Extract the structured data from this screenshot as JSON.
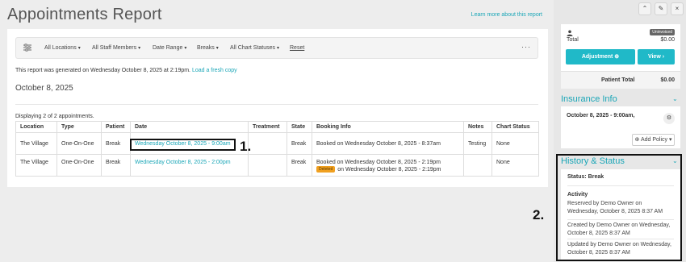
{
  "page_title": "Appointments Report",
  "learn_link": "Learn more about this report",
  "filters": {
    "locations": "All Locations",
    "staff": "All Staff Members",
    "date_range": "Date Range",
    "breaks": "Breaks",
    "chart_statuses": "All Chart Statuses",
    "reset": "Reset",
    "more": "···"
  },
  "generated": {
    "text": "This report was generated on Wednesday October 8, 2025 at 2:19pm.",
    "link": "Load a fresh copy"
  },
  "report_date": "October 8, 2025",
  "displaying": "Displaying 2 of 2 appointments.",
  "table": {
    "headers": [
      "Location",
      "Type",
      "Patient",
      "Date",
      "Treatment",
      "State",
      "Booking Info",
      "Notes",
      "Chart Status"
    ],
    "rows": [
      {
        "location": "The Village",
        "type": "One-On-One",
        "patient": "Break",
        "date": "Wednesday October 8, 2025 - 9:00am",
        "treatment": "",
        "state": "Break",
        "booking": "Booked on Wednesday October 8, 2025 - 8:37am",
        "notes": "Testing",
        "chart_status": "None"
      },
      {
        "location": "The Village",
        "type": "One-On-One",
        "patient": "Break",
        "date": "Wednesday October 8, 2025 - 2:00pm",
        "treatment": "",
        "state": "Break",
        "booking": "Booked on Wednesday October 8, 2025 - 2:19pm",
        "deleted_badge": "Deleted",
        "booking_deleted": "on Wednesday October 8, 2025 - 2:19pm",
        "notes": "",
        "chart_status": "None"
      }
    ]
  },
  "callouts": {
    "one": "1.",
    "two": "2."
  },
  "sidebar": {
    "icons": [
      "chevrons-up-icon",
      "pencil-icon",
      "close-icon"
    ],
    "uninvoiced": "Uninvoiced",
    "total_label": "Total",
    "total_value": "$0.00",
    "adjustment": "Adjustment",
    "view": "View",
    "patient_total_label": "Patient Total",
    "patient_total_value": "$0.00",
    "insurance_title": "Insurance Info",
    "insurance_date": "October 8, 2025 - 9:00am,",
    "add_policy": "Add Policy",
    "history_title": "History & Status",
    "status": "Status: Break",
    "activity_label": "Activity",
    "activity": [
      "Reserved by Demo Owner on Wednesday, October 8, 2025 8:37 AM",
      "Created by Demo Owner on Wednesday, October 8, 2025 8:37 AM",
      "Updated by Demo Owner on Wednesday, October 8, 2025 8:37 AM"
    ]
  },
  "colors": {
    "accent": "#1aa6b7",
    "button": "#20b9c8",
    "deleted": "#f0a020"
  }
}
